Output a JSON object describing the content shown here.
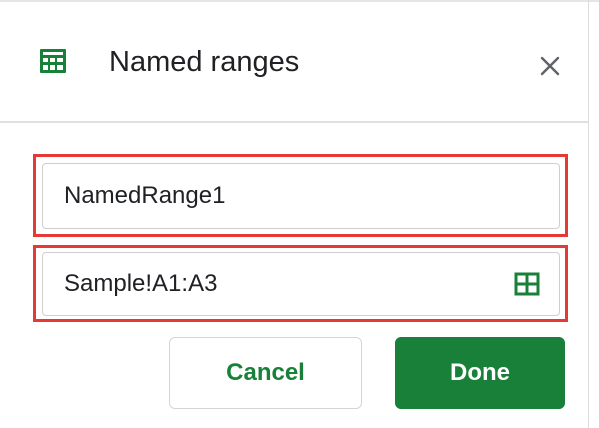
{
  "panel": {
    "title": "Named ranges",
    "icon": "sheets-table-icon",
    "close_icon": "close-icon"
  },
  "form": {
    "name_value": "NamedRange1",
    "range_value": "Sample!A1:A3",
    "range_picker_icon": "grid-select-icon"
  },
  "actions": {
    "cancel_label": "Cancel",
    "done_label": "Done"
  },
  "colors": {
    "accent": "#188038",
    "highlight": "#e53935",
    "text": "#202124"
  }
}
